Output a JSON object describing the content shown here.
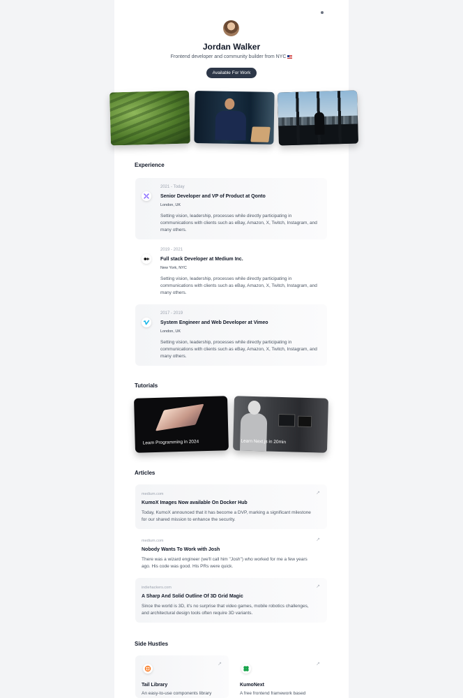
{
  "profile": {
    "name": "Jordan Walker",
    "bio": "Frontend developer and community builder from NYC",
    "status_badge": "Available For Work"
  },
  "sections": {
    "experience": "Experience",
    "tutorials": "Tutorials",
    "articles": "Articles",
    "side_hustles": "Side Hustles"
  },
  "experience": [
    {
      "date": "2021 - Today",
      "title": "Senior Developer and VP of Product at Qonto",
      "location": "London, UK",
      "description": "Setting vision, leadership, processes while directly participating in communications with clients such as eBay, Amazon, X, Twitch, Instagram, and many others.",
      "icon": "qonto-logo-icon",
      "color": "#7c5cff"
    },
    {
      "date": "2019 - 2021",
      "title": "Full stack Developer at Medium Inc.",
      "location": "New York, NYC",
      "description": "Setting vision, leadership, processes while directly participating in communications with clients such as eBay, Amazon, X, Twitch, Instagram, and many others.",
      "icon": "medium-logo-icon",
      "color": "#111111"
    },
    {
      "date": "2017 - 2019",
      "title": "System Engineer and Web Developer at Vimeo",
      "location": "London, UK",
      "description": "Setting vision, leadership, processes while directly participating in communications with clients such as eBay, Amazon, X, Twitch, Instagram, and many others.",
      "icon": "vimeo-logo-icon",
      "color": "#1ab7ea"
    }
  ],
  "tutorials": [
    {
      "caption": "Learn Programming in 2024"
    },
    {
      "caption": "Learn Next.js in 20min"
    }
  ],
  "articles": [
    {
      "source": "medium.com",
      "title": "KumoX Images Now available On Docker Hub",
      "description": "Today, KumoX announced that it has become a DVP, marking a significant milestone for our shared mission to enhance the security."
    },
    {
      "source": "medium.com",
      "title": "Nobody Wants To Work with Josh",
      "description": "There was a wizard engineer (we'll call him \"Josh\") who worked for me a few years ago. His code was good. His PRs were quick."
    },
    {
      "source": "indiehackers.com",
      "title": "A Sharp And Solid Outline Of 3D Grid Magic",
      "description": "Since the world is 3D, it's no surprise that video games, mobile robotics challenges, and architectural design tools often require 3D variants."
    }
  ],
  "side_hustles": [
    {
      "title": "Tail Library",
      "description": "An easy-to-use components library",
      "color": "#f97316"
    },
    {
      "title": "KumoNext",
      "description": "A free frontend framework based",
      "color": "#16a34a"
    }
  ],
  "colors": {
    "badge_bg": "#2d3748",
    "page_bg": "#f3f4f6",
    "card_bg": "#f4f5f7"
  }
}
